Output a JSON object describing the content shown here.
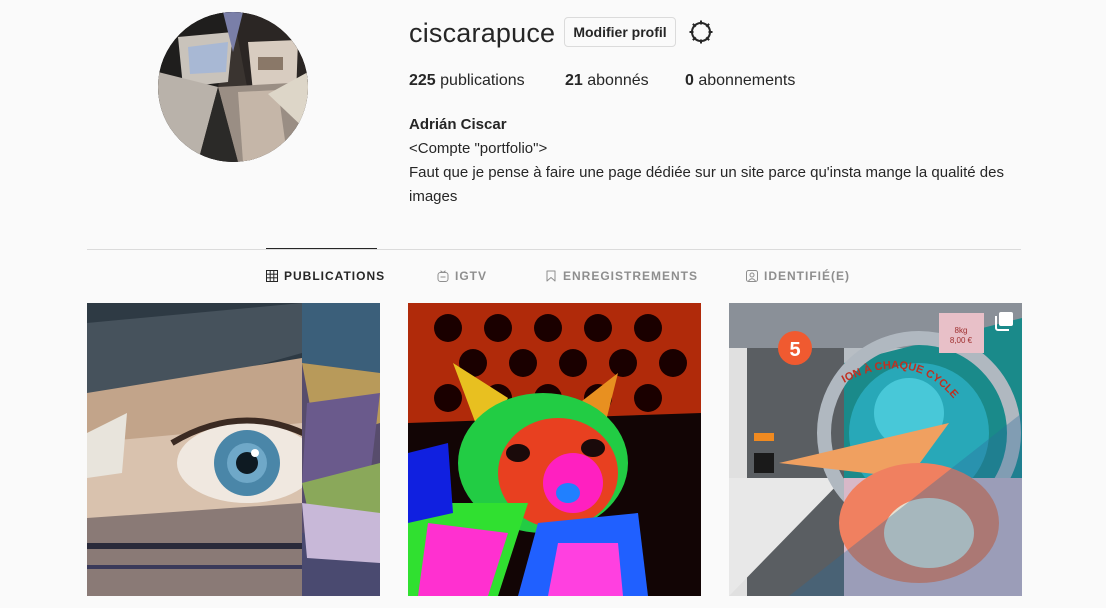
{
  "profile": {
    "username": "ciscarapuce",
    "edit_label": "Modifier profil",
    "settings_icon": "gear-icon",
    "stats": {
      "posts_count": "225",
      "posts_label": " publications",
      "followers_count": "21",
      "followers_label": " abonnés",
      "following_count": "0",
      "following_label": " abonnements"
    },
    "bio": {
      "name": "Adrián Ciscar",
      "line1": "<Compte \"portfolio\">",
      "line2": "Faut que je pense à faire une page dédiée sur un site parce qu'insta mange la qualité des images"
    }
  },
  "tabs": [
    {
      "label": "PUBLICATIONS",
      "icon": "grid-icon",
      "active": true
    },
    {
      "label": "IGTV",
      "icon": "igtv-icon",
      "active": false
    },
    {
      "label": "ENREGISTREMENTS",
      "icon": "bookmark-icon",
      "active": false
    },
    {
      "label": "IDENTIFIÉ(E)",
      "icon": "tagged-icon",
      "active": false
    }
  ],
  "posts": [
    {
      "subject": "eye collage",
      "multi": false
    },
    {
      "subject": "neon cat",
      "multi": false
    },
    {
      "subject": "washing machine collage",
      "multi": true
    }
  ],
  "post_texts": {
    "badge_number": "5",
    "curve_text": "ION À CHAQUE CYCLE",
    "price_line1": "8kg",
    "price_line2": "8,00 €"
  },
  "colors": {
    "text": "#262626",
    "muted": "#8e8e8e",
    "border": "#dbdbdb",
    "background": "#fafafa"
  }
}
